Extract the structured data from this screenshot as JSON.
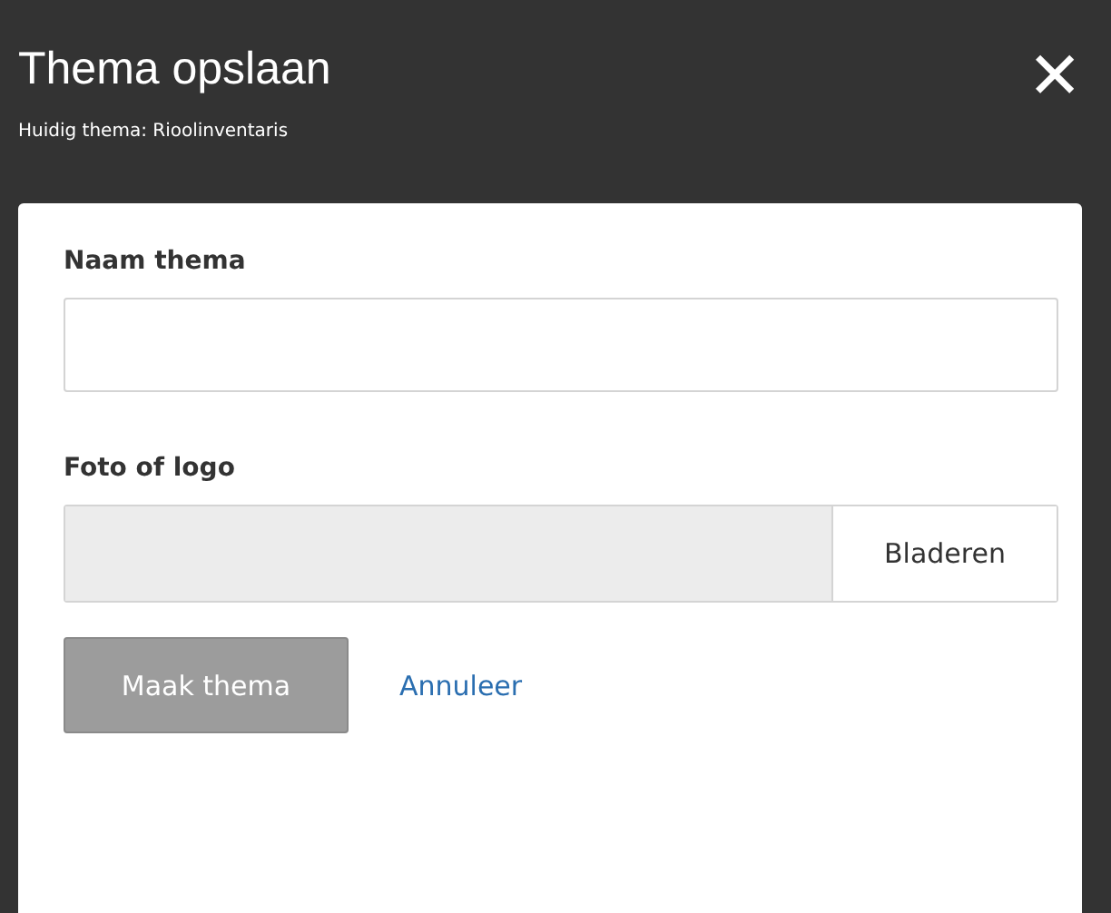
{
  "dialog": {
    "title": "Thema opslaan",
    "subtitle": "Huidig thema: Rioolinventaris",
    "close": "✕"
  },
  "fields": [
    {
      "kind": "text",
      "label": "Naam thema"
    },
    {
      "kind": "file",
      "label": "Foto of logo",
      "button": "Bladeren"
    }
  ],
  "actions": {
    "submit": {
      "label": "Maak thema",
      "disabled": true
    },
    "cancel": {
      "label": "Annuleer"
    }
  }
}
